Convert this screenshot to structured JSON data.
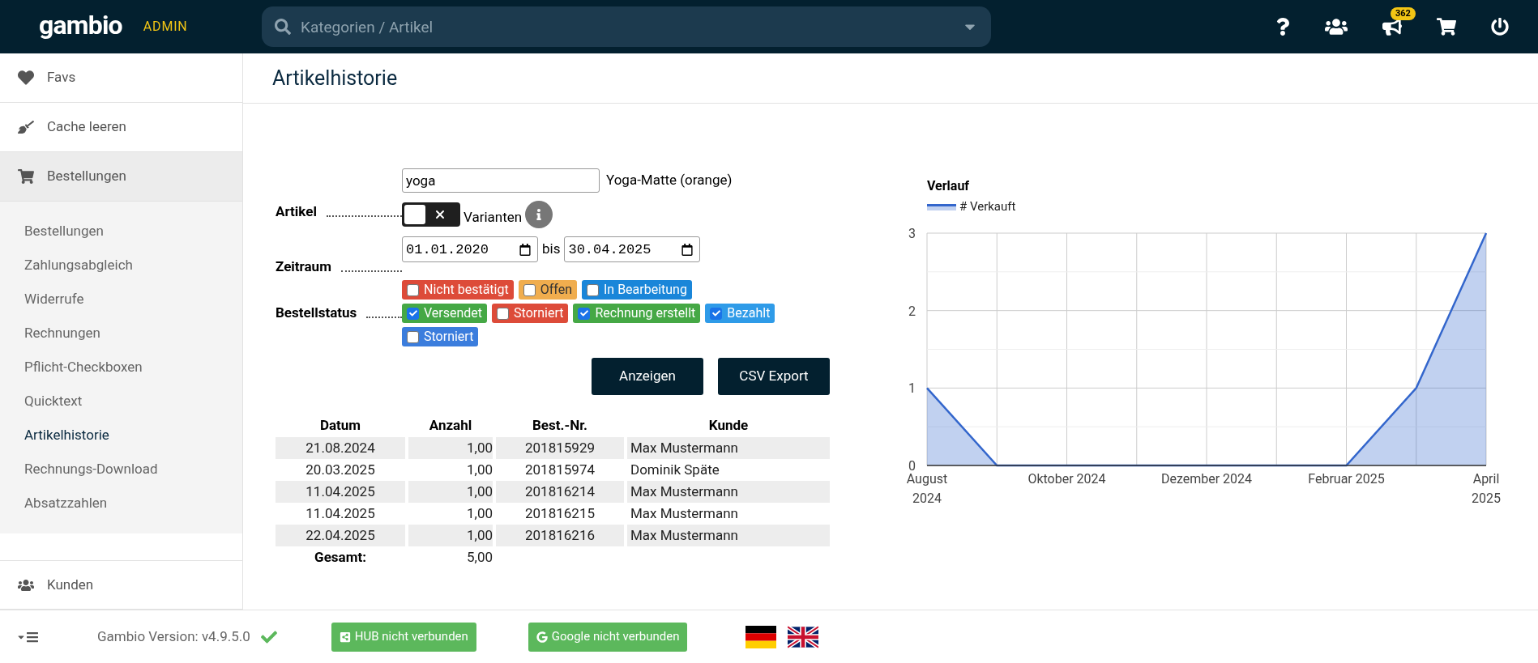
{
  "header": {
    "logo": "gambio",
    "logo_suffix": "ADMIN",
    "search": {
      "placeholder": "Kategorien / Artikel"
    },
    "notification_count": "362"
  },
  "sidebar": {
    "items": [
      {
        "label": "Favs",
        "kind": "heart",
        "selected": false
      },
      {
        "label": "Cache leeren",
        "kind": "brush",
        "selected": false
      },
      {
        "label": "Bestellungen",
        "kind": "cart",
        "selected": true,
        "expanded": true,
        "children": [
          {
            "label": "Bestellungen",
            "selected": false
          },
          {
            "label": "Zahlungsabgleich",
            "selected": false
          },
          {
            "label": "Widerrufe",
            "selected": false
          },
          {
            "label": "Rechnungen",
            "selected": false
          },
          {
            "label": "Pflicht-Checkboxen",
            "selected": false
          },
          {
            "label": "Quicktext",
            "selected": false
          },
          {
            "label": "Artikelhistorie",
            "selected": true
          },
          {
            "label": "Rechnungs-Download",
            "selected": false
          },
          {
            "label": "Absatzzahlen",
            "selected": false
          }
        ]
      },
      {
        "label": "Kunden",
        "kind": "users",
        "selected": false
      }
    ]
  },
  "page_title": "Artikelhistorie",
  "form": {
    "article_label": "Artikel",
    "article_value": "yoga",
    "article_match": "Yoga-Matte (orange)",
    "variants": {
      "label": "Varianten",
      "on": false
    },
    "period_label": "Zeitraum",
    "date_from": "01.01.2020",
    "date_separator": "bis",
    "date_to": "30.04.2025",
    "status_label": "Bestellstatus",
    "statuses": [
      [
        {
          "label": "Nicht bestätigt",
          "checked": false,
          "color": "#dd4b39"
        },
        {
          "label": "Offen",
          "checked": false,
          "color": "#f0ad4e"
        },
        {
          "label": "In Bearbeitung",
          "checked": false,
          "color": "#1a86d9"
        }
      ],
      [
        {
          "label": "Versendet",
          "checked": true,
          "color": "#45a845"
        },
        {
          "label": "Storniert",
          "checked": false,
          "color": "#dd4b39"
        },
        {
          "label": "Rechnung erstellt",
          "checked": true,
          "color": "#45a845"
        },
        {
          "label": "Bezahlt",
          "checked": true,
          "color": "#2f9be8"
        }
      ],
      [
        {
          "label": "Storniert",
          "checked": false,
          "color": "#3b7ddd"
        }
      ]
    ],
    "buttons": [
      "Anzeigen",
      "CSV Export"
    ]
  },
  "table": {
    "columns": [
      "Datum",
      "Anzahl",
      "Best.-Nr.",
      "Kunde"
    ],
    "rows": [
      [
        "21.08.2024",
        "1,00",
        "201815929",
        "Max Mustermann"
      ],
      [
        "20.03.2025",
        "1,00",
        "201815974",
        "Dominik Späte"
      ],
      [
        "11.04.2025",
        "1,00",
        "201816214",
        "Max Mustermann"
      ],
      [
        "11.04.2025",
        "1,00",
        "201816215",
        "Max Mustermann"
      ],
      [
        "22.04.2025",
        "1,00",
        "201816216",
        "Max Mustermann"
      ]
    ],
    "total_label": "Gesamt:",
    "total_value": "5,00"
  },
  "chart": {
    "chart_data": {
      "type": "area",
      "title": "Verlauf",
      "categories": [
        "August 2024",
        null,
        "Oktober 2024",
        null,
        "Dezember 2024",
        null,
        "Februar 2025",
        null,
        "April 2025"
      ],
      "series": [
        {
          "name": "# Verkauft",
          "color": "#3366cc",
          "values": [
            1,
            0,
            0,
            0,
            0,
            0,
            0,
            1,
            3
          ]
        }
      ],
      "ylim": [
        0,
        3
      ],
      "grid": true,
      "yticks": [
        0,
        1,
        2,
        3
      ]
    }
  },
  "footer": {
    "version": "Gambio Version: v4.9.5.0",
    "version_ok": true,
    "buttons": [
      {
        "label": "HUB nicht verbunden",
        "kind": "share"
      },
      {
        "label": "Google nicht verbunden",
        "kind": "google"
      }
    ]
  }
}
